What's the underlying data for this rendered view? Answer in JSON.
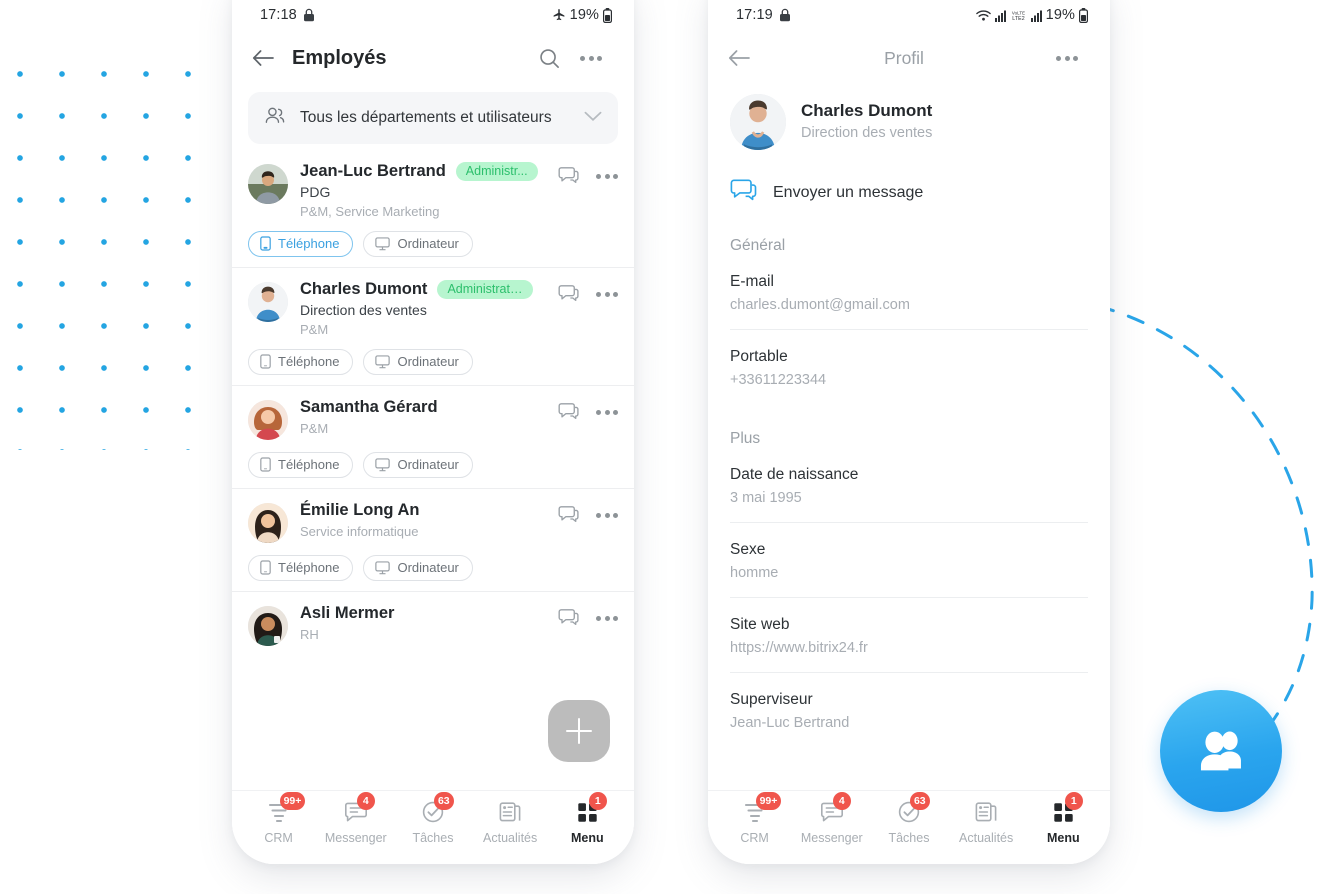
{
  "colors": {
    "accent_blue": "#1f96e8",
    "dot_blue": "#18a0e0",
    "badge_green_bg": "#b7f5cf",
    "badge_green_text": "#2cbf6c",
    "nav_badge_red": "#f0554c",
    "chip_active": "#3aa0e0"
  },
  "phone_left": {
    "statusbar": {
      "time": "17:18",
      "lock_icon": "lock-icon",
      "airplane_icon": "airplane-icon",
      "battery_pct": "19%",
      "battery_icon": "battery-icon"
    },
    "appbar": {
      "back_icon": "back-arrow-icon",
      "title": "Employés",
      "search_icon": "search-icon",
      "more_icon": "more-options-icon"
    },
    "dept_selector": {
      "icon": "people-group-icon",
      "label": "Tous les départements et utilisateurs",
      "chevron": "chevron-down-icon"
    },
    "chip_labels": {
      "phone": "Téléphone",
      "computer": "Ordinateur"
    },
    "employees": [
      {
        "name": "Jean-Luc Bertrand",
        "badge": "Administr...",
        "role": "PDG",
        "department": "P&M, Service Marketing",
        "chips": [
          {
            "label": "Téléphone",
            "icon": "mobile-icon",
            "active": true
          },
          {
            "label": "Ordinateur",
            "icon": "monitor-icon",
            "active": false
          }
        ]
      },
      {
        "name": "Charles Dumont",
        "badge": "Administrateur",
        "role": "Direction des ventes",
        "department": "P&M",
        "chips": [
          {
            "label": "Téléphone",
            "icon": "mobile-icon",
            "active": false
          },
          {
            "label": "Ordinateur",
            "icon": "monitor-icon",
            "active": false
          }
        ]
      },
      {
        "name": "Samantha Gérard",
        "badge": "",
        "role": "",
        "department": "P&M",
        "chips": [
          {
            "label": "Téléphone",
            "icon": "mobile-icon",
            "active": false
          },
          {
            "label": "Ordinateur",
            "icon": "monitor-icon",
            "active": false
          }
        ]
      },
      {
        "name": "Émilie Long An",
        "badge": "",
        "role": "",
        "department": "Service informatique",
        "chips": [
          {
            "label": "Téléphone",
            "icon": "mobile-icon",
            "active": false
          },
          {
            "label": "Ordinateur",
            "icon": "monitor-icon",
            "active": false
          }
        ]
      },
      {
        "name": "Asli Mermer",
        "badge": "",
        "role": "",
        "department": "RH",
        "chips": []
      }
    ],
    "row_actions": {
      "chat_icon": "chat-bubbles-icon",
      "more_icon": "more-options-icon"
    },
    "fab": {
      "icon": "plus-icon"
    }
  },
  "phone_right": {
    "statusbar": {
      "time": "17:19",
      "lock_icon": "lock-icon",
      "wifi_icon": "wifi-icon",
      "signal_icon": "signal-bars-icon",
      "volte_label": "VoLTE",
      "battery_pct": "19%",
      "battery_icon": "battery-icon"
    },
    "appbar": {
      "back_icon": "back-arrow-icon",
      "title": "Profil",
      "more_icon": "more-options-icon"
    },
    "profile": {
      "name": "Charles Dumont",
      "role": "Direction des ventes",
      "send_message": {
        "icon": "chat-bubbles-icon",
        "label": "Envoyer un message"
      },
      "sections": [
        {
          "title": "Général",
          "fields": [
            {
              "label": "E-mail",
              "value": "charles.dumont@gmail.com"
            },
            {
              "label": "Portable",
              "value": "+33611223344"
            }
          ]
        },
        {
          "title": "Plus",
          "fields": [
            {
              "label": "Date de naissance",
              "value": "3 mai 1995"
            },
            {
              "label": "Sexe",
              "value": "homme"
            },
            {
              "label": "Site web",
              "value": "https://www.bitrix24.fr"
            },
            {
              "label": "Superviseur",
              "value": "Jean-Luc Bertrand"
            }
          ]
        }
      ]
    }
  },
  "bottom_nav": {
    "items": [
      {
        "label": "CRM",
        "badge": "99+",
        "icon": "crm-funnel-icon",
        "active": false
      },
      {
        "label": "Messenger",
        "badge": "4",
        "icon": "message-icon",
        "active": false
      },
      {
        "label": "Tâches",
        "badge": "63",
        "icon": "check-circle-icon",
        "active": false
      },
      {
        "label": "Actualités",
        "badge": "",
        "icon": "news-icon",
        "active": false
      },
      {
        "label": "Menu",
        "badge": "1",
        "icon": "grid-menu-icon",
        "active": true
      }
    ]
  },
  "decor": {
    "dot_grid": "decorative-dot-grid",
    "dashed_arc": "decorative-dashed-arc",
    "people_badge_icon": "two-people-icon"
  }
}
